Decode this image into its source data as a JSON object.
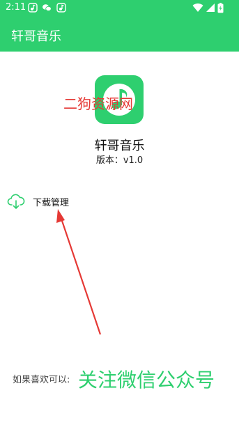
{
  "status_bar": {
    "time": "2:11",
    "icons": [
      "music-notification-icon",
      "wechat-icon",
      "music-notification-icon",
      "wifi-icon",
      "signal-icon",
      "battery-charging-icon"
    ]
  },
  "app_bar": {
    "title": "轩哥音乐"
  },
  "about": {
    "watermark": "二狗资源网",
    "app_name": "轩哥音乐",
    "version": "版本：v1.0"
  },
  "menu": {
    "download_label": "下载管理",
    "download_icon": "cloud-download-icon"
  },
  "footer": {
    "prompt": "如果喜欢可以:",
    "cta": "关注微信公众号"
  },
  "colors": {
    "accent": "#2ecf6f",
    "annotation": "#e53935"
  }
}
